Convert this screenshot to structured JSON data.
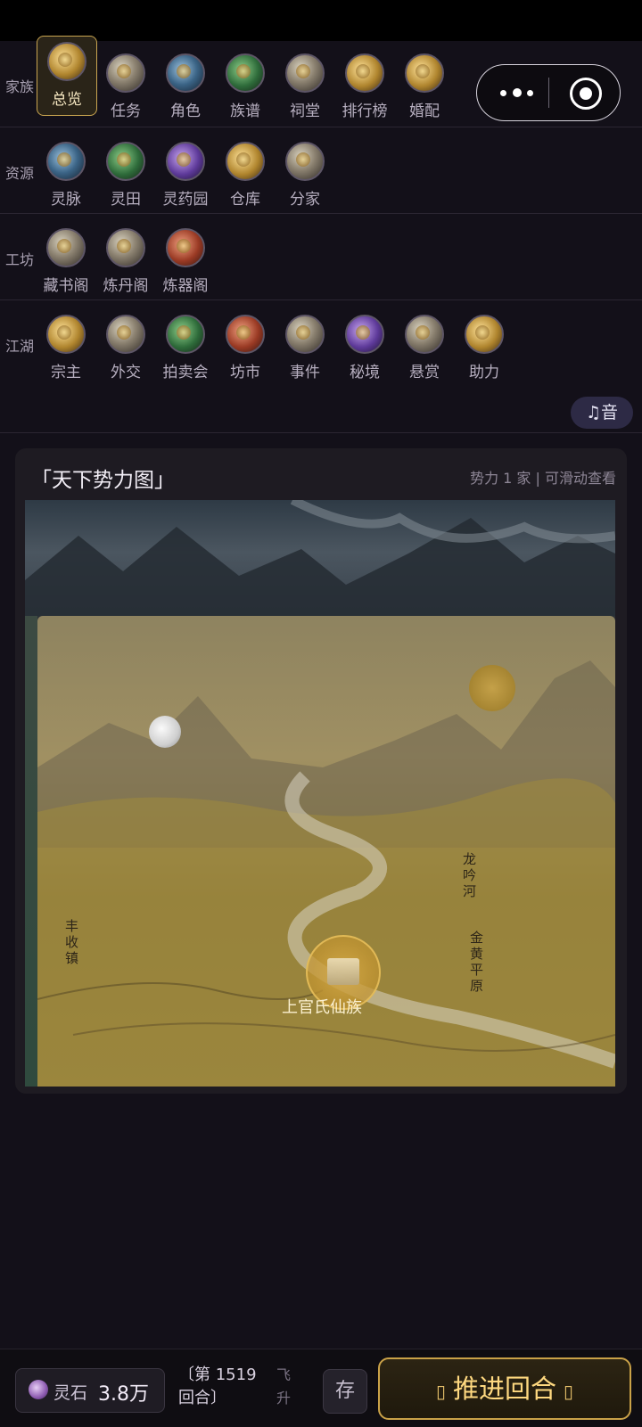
{
  "nav": {
    "sections": [
      {
        "label": "家族",
        "items": [
          "总览",
          "任务",
          "角色",
          "族谱",
          "祠堂",
          "排行榜",
          "婚配"
        ]
      },
      {
        "label": "资源",
        "items": [
          "灵脉",
          "灵田",
          "灵药园",
          "仓库",
          "分家"
        ]
      },
      {
        "label": "工坊",
        "items": [
          "藏书阁",
          "炼丹阁",
          "炼器阁"
        ]
      },
      {
        "label": "江湖",
        "items": [
          "宗主",
          "外交",
          "拍卖会",
          "坊市",
          "事件",
          "秘境",
          "悬赏",
          "助力"
        ]
      }
    ],
    "active_item": "总览"
  },
  "music_button": {
    "label": "♫音"
  },
  "map_panel": {
    "title": "「天下势力图」",
    "meta": "势力 1 家  |  可滑动查看",
    "places": {
      "town": "丰收镇",
      "river": "龙吟河",
      "plain": "金黄平原"
    },
    "clan_label": "上官氏仙族"
  },
  "bottom_bar": {
    "stone_label": "灵石",
    "stone_value": "3.8万",
    "turn": "〔第 1519 回合〕",
    "ascend": "飞升",
    "save_label": "存",
    "advance_label": "推进回合"
  },
  "colors": {
    "accent_gold": "#caa248",
    "background": "#131019"
  }
}
